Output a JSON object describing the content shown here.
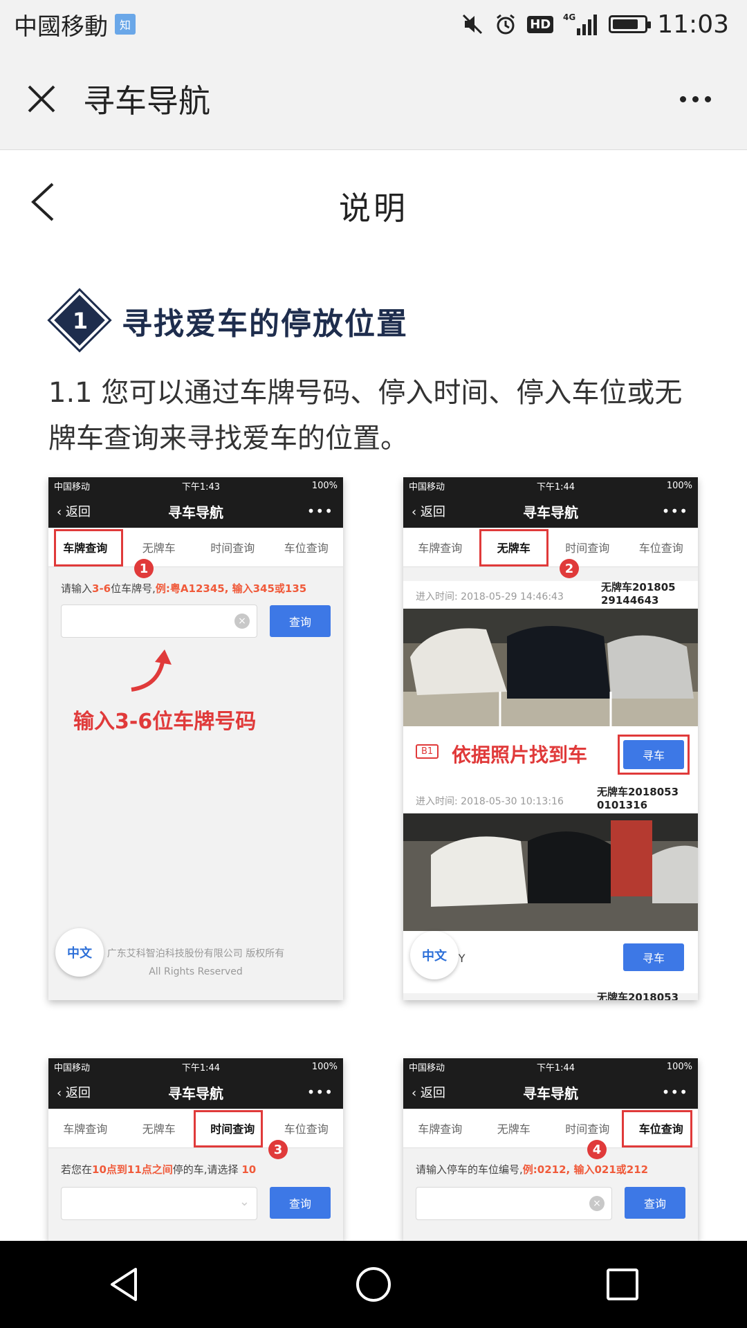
{
  "status_bar": {
    "carrier": "中國移動",
    "carrier_badge": "知",
    "hd": "HD",
    "network": "4G",
    "time": "11:03"
  },
  "wx_bar": {
    "title": "寻车导航"
  },
  "page": {
    "title": "说明"
  },
  "section": {
    "number": "1",
    "title": "寻找爱车的停放位置",
    "paragraph": "1.1 您可以通过车牌号码、停入时间、停入车位或无牌车查询来寻找爱车的位置。"
  },
  "mini": {
    "carrier": "中国移动",
    "battery": "100%",
    "back": "返回",
    "title": "寻车导航",
    "tabs": [
      "车牌查询",
      "无牌车",
      "时间查询",
      "车位查询"
    ],
    "search_btn": "查询",
    "find_btn": "寻车",
    "lang": "中文"
  },
  "shots": [
    {
      "time": "下午1:43",
      "badge": "1",
      "hint_prefix": "请输入",
      "hint_red1": "3-6",
      "hint_mid": "位车牌号,",
      "hint_red2": "例:粤A12345, 输入345或135",
      "annotation": "输入3-6位车牌号码",
      "footer1": "广东艾科智泊科技股份有限公司 版权所有",
      "footer2": "All Rights Reserved"
    },
    {
      "time": "下午1:44",
      "badge": "2",
      "records": [
        {
          "time": "进入时间: 2018-05-29 14:46:43",
          "plate": "无牌车201805 29144643"
        },
        {
          "time": "进入时间: 2018-05-30 10:13:16",
          "plate": "无牌车2018053 0101316"
        }
      ],
      "level": "B1",
      "annotation": "依据照片找到车",
      "third_partial": "无牌车2018053",
      "ty": "TY"
    },
    {
      "time": "下午1:44",
      "badge": "3",
      "hint_prefix": "若您在",
      "hint_red": "10点到11点之间",
      "hint_mid": "停的车,请选择",
      "hint_red2": "10"
    },
    {
      "time": "下午1:44",
      "badge": "4",
      "hint_prefix": "请输入停车的车位编号,",
      "hint_red": "例:0212, 输入021或212"
    }
  ]
}
